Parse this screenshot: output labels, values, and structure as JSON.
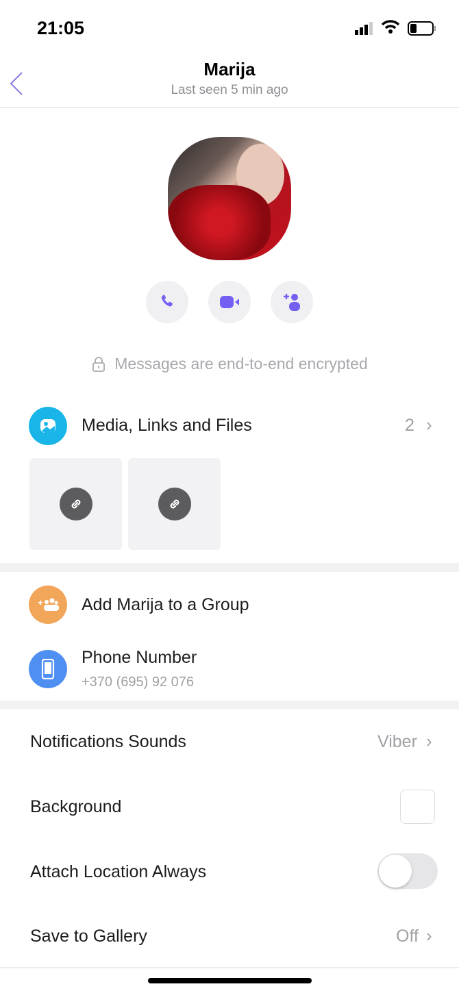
{
  "status_bar": {
    "time": "21:05"
  },
  "header": {
    "title": "Marija",
    "subtitle": "Last seen 5 min ago"
  },
  "actions": [
    {
      "icon": "phone-icon"
    },
    {
      "icon": "video-icon"
    },
    {
      "icon": "add-contact-icon"
    }
  ],
  "encryption_note": "Messages are end-to-end encrypted",
  "media": {
    "label": "Media, Links and Files",
    "count": "2",
    "items": [
      {
        "icon": "link-icon"
      },
      {
        "icon": "link-icon"
      }
    ]
  },
  "add_group": {
    "label": "Add Marija to a Group"
  },
  "phone": {
    "label": "Phone Number",
    "value": "+370 (695) 92 076"
  },
  "settings": {
    "notifications": {
      "label": "Notifications Sounds",
      "value": "Viber"
    },
    "background": {
      "label": "Background"
    },
    "attach_location": {
      "label": "Attach Location Always",
      "on": false
    },
    "save_gallery": {
      "label": "Save to Gallery",
      "value": "Off"
    }
  },
  "colors": {
    "accent": "#7360f2",
    "media_icon": "#1ab5e8",
    "group_icon": "#f2a65a",
    "phone_icon": "#4f8ff2"
  }
}
